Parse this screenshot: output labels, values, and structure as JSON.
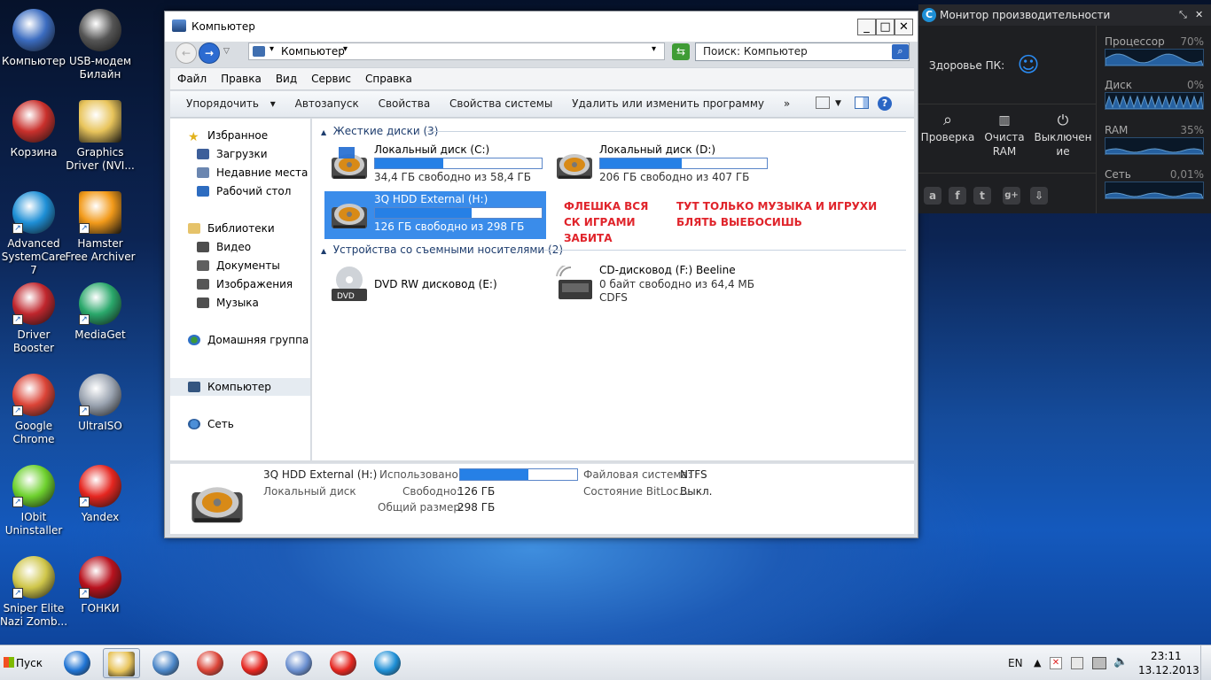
{
  "desktop_icons": [
    {
      "label": "Компьютер",
      "icon": "computer-icon",
      "color": "#3b6cc0"
    },
    {
      "label": "USB-модем Билайн",
      "icon": "usb-modem-icon",
      "color": "#555"
    },
    {
      "label": "Корзина",
      "icon": "recycle-bin-icon",
      "color": "#c9302c"
    },
    {
      "label": "Graphics Driver (NVI...",
      "icon": "folder-icon",
      "color": "#e8c45b"
    },
    {
      "label": "Advanced SystemCare 7",
      "icon": "advanced-systemcare-icon",
      "color": "#1e8fd6"
    },
    {
      "label": "Hamster Free Archiver",
      "icon": "hamster-archiver-icon",
      "color": "#f29a1a"
    },
    {
      "label": "Driver Booster",
      "icon": "driver-booster-icon",
      "color": "#c0262d"
    },
    {
      "label": "MediaGet",
      "icon": "mediaget-icon",
      "color": "#2aa86b"
    },
    {
      "label": "Google Chrome",
      "icon": "chrome-icon",
      "color": "#db4437"
    },
    {
      "label": "UltraISO",
      "icon": "ultraiso-icon",
      "color": "#9aa3b0"
    },
    {
      "label": "IObit Uninstaller",
      "icon": "iobit-uninstaller-icon",
      "color": "#6ed12e"
    },
    {
      "label": "Yandex",
      "icon": "yandex-browser-icon",
      "color": "#e52620"
    },
    {
      "label": "Sniper Elite Nazi Zomb...",
      "icon": "sniper-elite-icon",
      "color": "#cfc64a"
    },
    {
      "label": "ГОНКИ",
      "icon": "racing-game-icon",
      "color": "#b8121e"
    }
  ],
  "explorer": {
    "title": "Компьютер",
    "address": "Компьютер",
    "search_placeholder": "Поиск: Компьютер",
    "menu": [
      "Файл",
      "Правка",
      "Вид",
      "Сервис",
      "Справка"
    ],
    "commands": [
      "Упорядочить",
      "Автозапуск",
      "Свойства",
      "Свойства системы",
      "Удалить или изменить программу",
      "»"
    ],
    "nav": {
      "favorites": "Избранное",
      "downloads": "Загрузки",
      "recent": "Недавние места",
      "desktop": "Рабочий стол",
      "libraries": "Библиотеки",
      "video": "Видео",
      "documents": "Документы",
      "images": "Изображения",
      "music": "Музыка",
      "homegroup": "Домашняя группа",
      "computer": "Компьютер",
      "network": "Сеть"
    },
    "hard_drives_header": "Жесткие диски (3)",
    "drives": [
      {
        "name": "Локальный диск (C:)",
        "free": "34,4 ГБ свободно из 58,4 ГБ",
        "used_fraction": 0.41
      },
      {
        "name": "Локальный диск (D:)",
        "free": "206 ГБ свободно из 407 ГБ",
        "used_fraction": 0.49
      },
      {
        "name": "3Q HDD External (H:)",
        "free": "126 ГБ свободно из 298 ГБ",
        "used_fraction": 0.58
      }
    ],
    "annotation_1": "ФЛЕШКА ВСЯ СК ИГРАМИ ЗАБИТА",
    "annotation_2": "ТУТ ТОЛЬКО МУЗЫКА И ИГРУХИ БЛЯТЬ ВЫЕБОСИШЬ",
    "removable_header": "Устройства со съемными носителями (2)",
    "dvd": {
      "name": "DVD RW дисковод (E:)"
    },
    "cd": {
      "name": "CD-дисковод (F:) Beeline",
      "free": "0 байт свободно из 64,4 МБ",
      "fs": "CDFS"
    },
    "details": {
      "name": "3Q HDD External (H:)",
      "type": "Локальный диск",
      "used_label": "Использовано:",
      "free_label": "Свободно:",
      "free_value": "126 ГБ",
      "total_label": "Общий размер:",
      "total_value": "298 ГБ",
      "fs_label": "Файловая система:",
      "fs_value": "NTFS",
      "bitlocker_label": "Состояние BitLoc...",
      "bitlocker_value": "Выкл.",
      "used_fraction": 0.58
    }
  },
  "perf_monitor": {
    "title": "Монитор производительности",
    "health_label": "Здоровье ПК:",
    "graphs": [
      {
        "label": "Процессор",
        "value": "70%"
      },
      {
        "label": "Диск",
        "value": "0%"
      },
      {
        "label": "RAM",
        "value": "35%"
      },
      {
        "label": "Сеть",
        "value": "0,01%"
      }
    ],
    "buttons": [
      {
        "label": "Проверка",
        "icon": "search-icon"
      },
      {
        "label": "Очиста RAM",
        "icon": "ram-icon"
      },
      {
        "label": "Выключение",
        "icon": "power-icon"
      }
    ],
    "social": [
      "a",
      "f",
      "t",
      "g+",
      "⇩"
    ]
  },
  "taskbar": {
    "start": "Пуск",
    "apps": [
      "internet-explorer-icon",
      "explorer-folder-icon",
      "media-player-icon",
      "chrome-icon",
      "yandex-search-icon",
      "volume-app-icon",
      "yandex-browser-icon",
      "advanced-systemcare-icon"
    ],
    "lang": "EN",
    "time": "23:11",
    "date": "13.12.2013"
  }
}
